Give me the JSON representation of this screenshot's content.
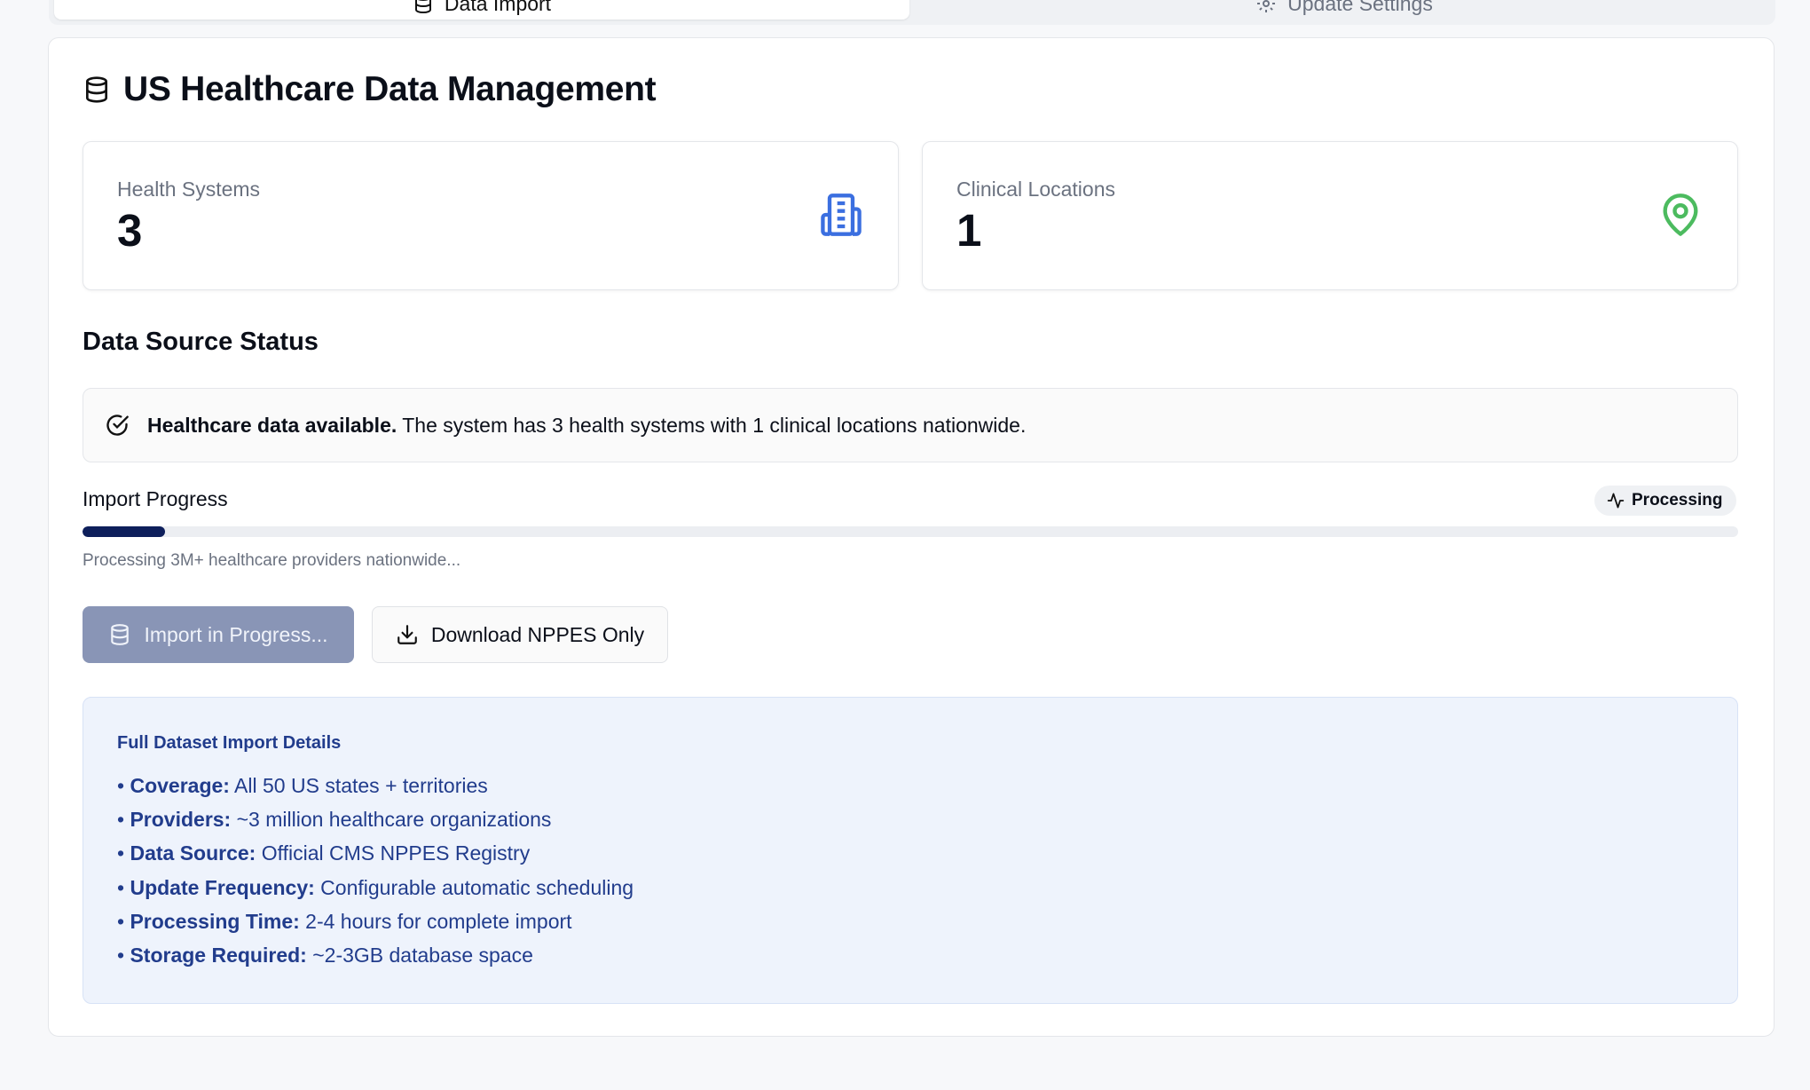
{
  "tabs": [
    {
      "label": "Data Import",
      "icon": "database-icon"
    },
    {
      "label": "Update Settings",
      "icon": "gear-icon"
    }
  ],
  "title": "US Healthcare Data Management",
  "stats": [
    {
      "label": "Health Systems",
      "value": "3",
      "icon": "building-icon",
      "color": "#3b6fe0"
    },
    {
      "label": "Clinical Locations",
      "value": "1",
      "icon": "map-pin-icon",
      "color": "#4cbb5f"
    }
  ],
  "section_title": "Data Source Status",
  "alert": {
    "bold": "Healthcare data available.",
    "text": " The system has 3 health systems with 1 clinical locations nationwide."
  },
  "progress": {
    "label": "Import Progress",
    "badge": "Processing",
    "value": 0.05,
    "note": "Processing 3M+ healthcare providers nationwide..."
  },
  "buttons": {
    "import": "Import in Progress...",
    "download": "Download NPPES Only"
  },
  "details": {
    "title": "Full Dataset Import Details",
    "items": [
      {
        "key": "Coverage:",
        "value": " All 50 US states + territories"
      },
      {
        "key": "Providers:",
        "value": " ~3 million healthcare organizations"
      },
      {
        "key": "Data Source:",
        "value": " Official CMS NPPES Registry"
      },
      {
        "key": "Update Frequency:",
        "value": " Configurable automatic scheduling"
      },
      {
        "key": "Processing Time:",
        "value": " 2-4 hours for complete import"
      },
      {
        "key": "Storage Required:",
        "value": " ~2-3GB database space"
      }
    ]
  }
}
